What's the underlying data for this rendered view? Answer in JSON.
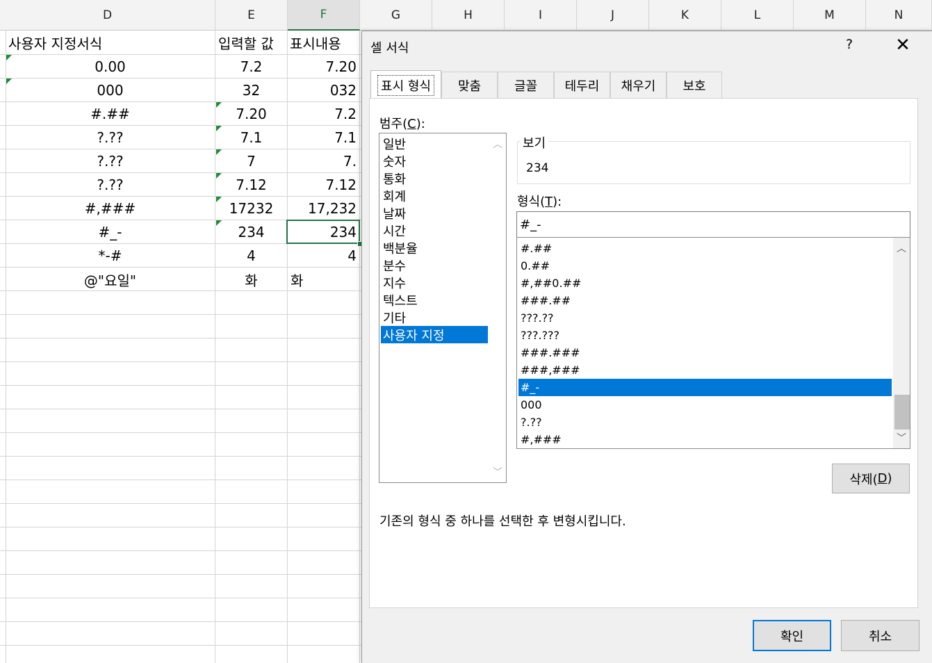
{
  "sheet": {
    "columns": [
      "D",
      "E",
      "F",
      "G",
      "H",
      "I",
      "J",
      "K",
      "L",
      "M",
      "N"
    ],
    "selected_column": "F",
    "headers": {
      "d": "사용자 지정서식",
      "e": "입력할 값",
      "f": "표시내용"
    },
    "rows": [
      {
        "format": "0.00",
        "input": "7.2",
        "display": "7.20"
      },
      {
        "format": "000",
        "input": "32",
        "display": "032"
      },
      {
        "format": "#.##",
        "input": "7.20",
        "display": "7.2"
      },
      {
        "format": "?.??",
        "input": "7.1",
        "display": "7.1"
      },
      {
        "format": "?.??",
        "input": "7",
        "display": "7."
      },
      {
        "format": "?.??",
        "input": "7.12",
        "display": "7.12"
      },
      {
        "format": "#,###",
        "input": "17232",
        "display": "17,232"
      },
      {
        "format": "#_-",
        "input": "234",
        "display": "234"
      },
      {
        "format": "*-#",
        "input": "4",
        "display": "4"
      },
      {
        "format": "@\"요일\"",
        "input": "화",
        "display": "화"
      }
    ]
  },
  "dialog": {
    "title": "셀 서식",
    "help": "?",
    "close": "✕",
    "tabs": [
      "표시 형식",
      "맞춤",
      "글꼴",
      "테두리",
      "채우기",
      "보호"
    ],
    "active_tab": "표시 형식",
    "category_label": "범주(",
    "category_key": "C",
    "category_label_end": "):",
    "categories": [
      "일반",
      "숫자",
      "통화",
      "회계",
      "날짜",
      "시간",
      "백분율",
      "분수",
      "지수",
      "텍스트",
      "기타",
      "사용자 지정"
    ],
    "selected_category": "사용자 지정",
    "preview_label": "보기",
    "preview_value": "234",
    "type_label": "형식(",
    "type_key": "T",
    "type_label_end": "):",
    "type_value": "#_-",
    "formats": [
      "#.##",
      "0.##",
      "#,##0.##",
      "###.##",
      "???.??",
      "???.???",
      "###.###",
      "###,###",
      "#_-",
      "000",
      "?.??",
      "#,###"
    ],
    "selected_format": "#_-",
    "delete_label": "삭제(",
    "delete_key": "D",
    "delete_label_end": ")",
    "hint": "기존의 형식 중 하나를 선택한 후 변형시킵니다.",
    "ok": "확인",
    "cancel": "취소"
  }
}
